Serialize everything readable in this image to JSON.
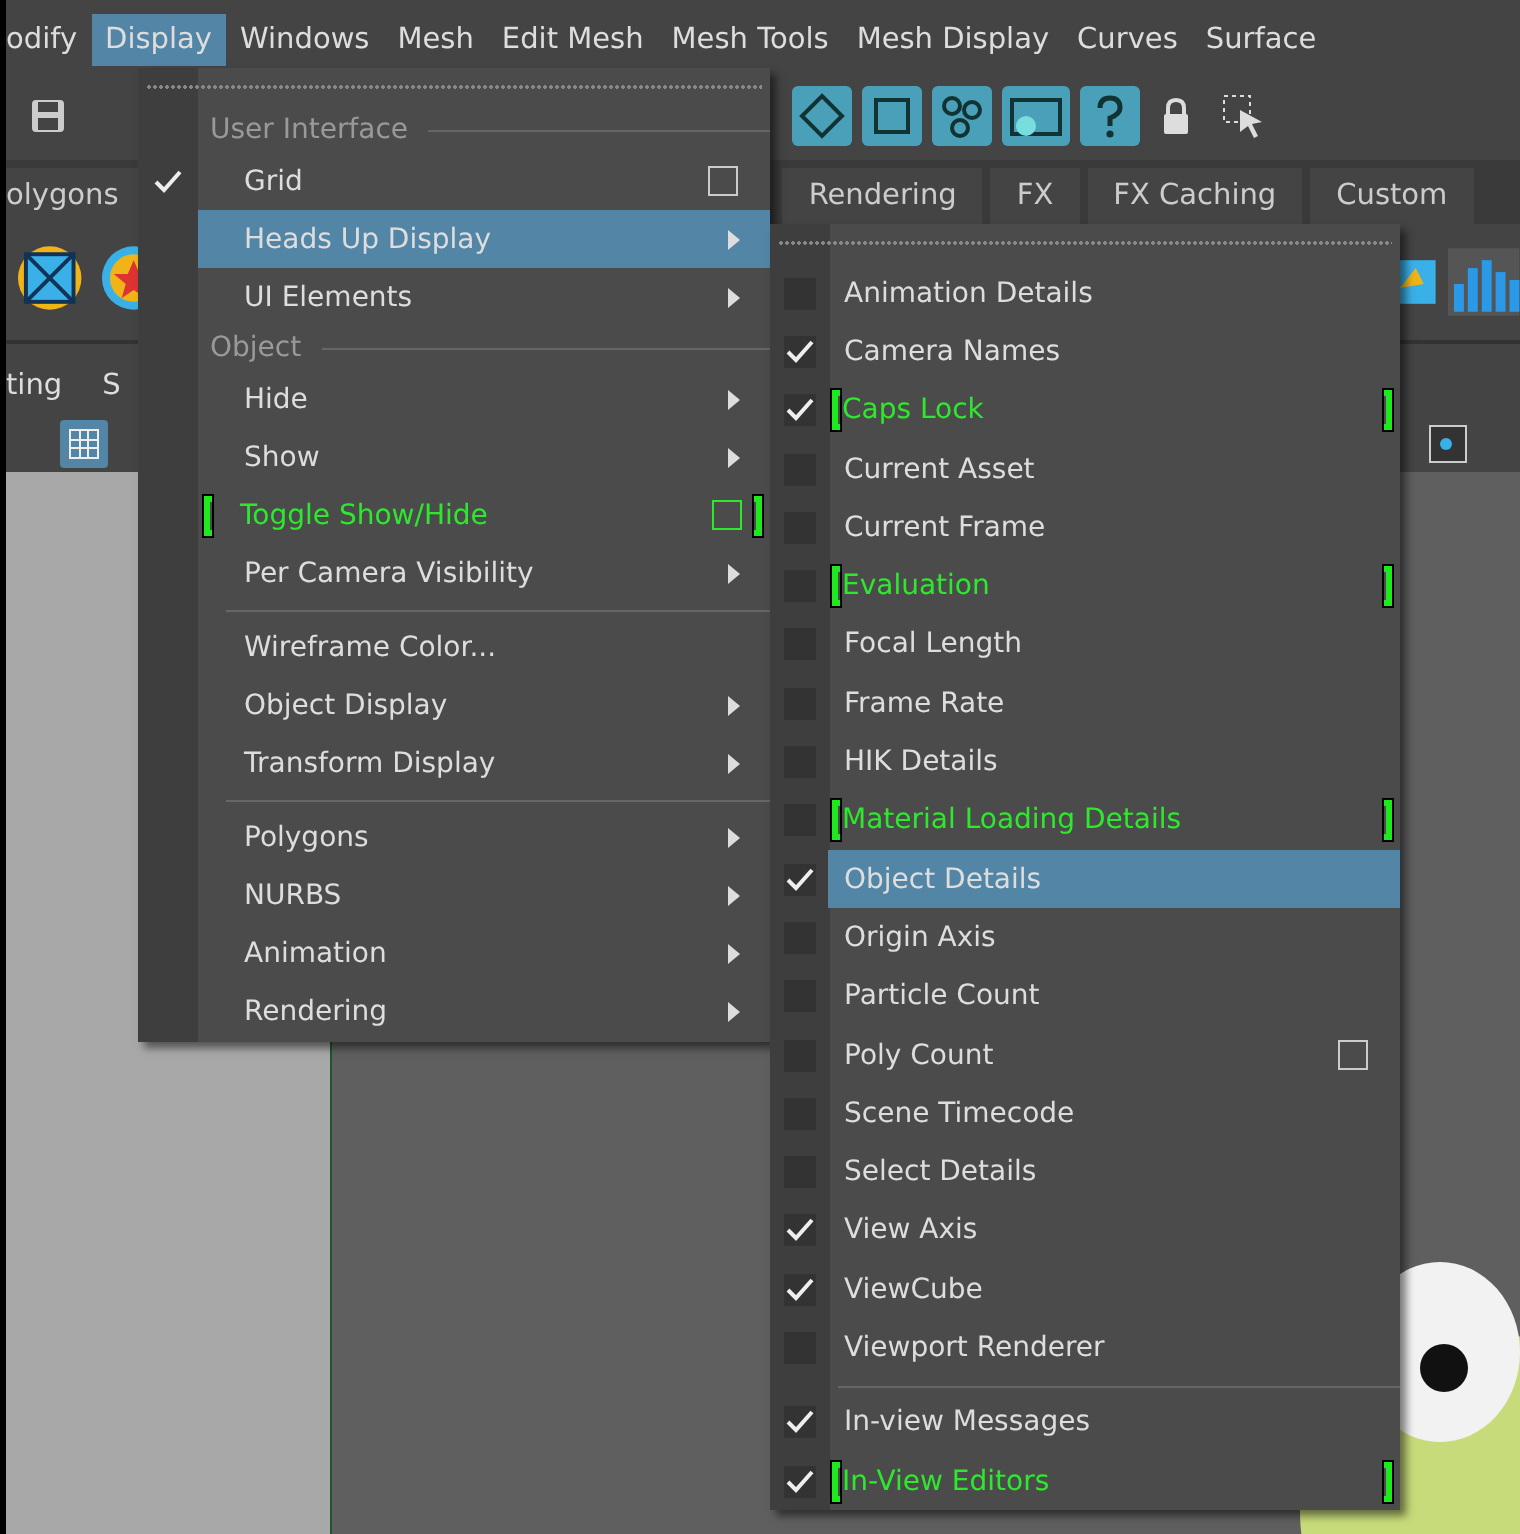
{
  "menubar": [
    {
      "label": "odify",
      "selected": false
    },
    {
      "label": "Display",
      "selected": true
    },
    {
      "label": "Windows",
      "selected": false
    },
    {
      "label": "Mesh",
      "selected": false
    },
    {
      "label": "Edit Mesh",
      "selected": false
    },
    {
      "label": "Mesh Tools",
      "selected": false
    },
    {
      "label": "Mesh Display",
      "selected": false
    },
    {
      "label": "Curves",
      "selected": false
    },
    {
      "label": "Surface",
      "selected": false
    }
  ],
  "shelf_tabs": [
    "olygons",
    "Rendering",
    "FX",
    "FX Caching",
    "Custom"
  ],
  "panel_menu": [
    "ting",
    "S"
  ],
  "display_menu": {
    "items": [
      {
        "kind": "section",
        "label": "User Interface"
      },
      {
        "kind": "item",
        "label": "Grid",
        "checked": true,
        "selected": false,
        "submenu": false,
        "option_box": true,
        "annotated": false
      },
      {
        "kind": "item",
        "label": "Heads Up Display",
        "checked": false,
        "selected": true,
        "submenu": true,
        "option_box": false,
        "annotated": false
      },
      {
        "kind": "item",
        "label": "UI Elements",
        "checked": false,
        "selected": false,
        "submenu": true,
        "option_box": false,
        "annotated": false
      },
      {
        "kind": "section",
        "label": "Object"
      },
      {
        "kind": "item",
        "label": "Hide",
        "checked": false,
        "selected": false,
        "submenu": true,
        "option_box": false,
        "annotated": false
      },
      {
        "kind": "item",
        "label": "Show",
        "checked": false,
        "selected": false,
        "submenu": true,
        "option_box": false,
        "annotated": false
      },
      {
        "kind": "item",
        "label": "Toggle Show/Hide",
        "checked": false,
        "selected": false,
        "submenu": false,
        "option_box": true,
        "annotated": true
      },
      {
        "kind": "item",
        "label": "Per Camera Visibility",
        "checked": false,
        "selected": false,
        "submenu": true,
        "option_box": false,
        "annotated": false
      },
      {
        "kind": "separator"
      },
      {
        "kind": "item",
        "label": "Wireframe Color...",
        "checked": false,
        "selected": false,
        "submenu": false,
        "option_box": false,
        "annotated": false
      },
      {
        "kind": "item",
        "label": "Object Display",
        "checked": false,
        "selected": false,
        "submenu": true,
        "option_box": false,
        "annotated": false
      },
      {
        "kind": "item",
        "label": "Transform Display",
        "checked": false,
        "selected": false,
        "submenu": true,
        "option_box": false,
        "annotated": false
      },
      {
        "kind": "separator"
      },
      {
        "kind": "item",
        "label": "Polygons",
        "checked": false,
        "selected": false,
        "submenu": true,
        "option_box": false,
        "annotated": false
      },
      {
        "kind": "item",
        "label": "NURBS",
        "checked": false,
        "selected": false,
        "submenu": true,
        "option_box": false,
        "annotated": false
      },
      {
        "kind": "item",
        "label": "Animation",
        "checked": false,
        "selected": false,
        "submenu": true,
        "option_box": false,
        "annotated": false
      },
      {
        "kind": "item",
        "label": "Rendering",
        "checked": false,
        "selected": false,
        "submenu": true,
        "option_box": false,
        "annotated": false
      }
    ]
  },
  "hud_menu": {
    "items": [
      {
        "kind": "item",
        "label": "Animation Details",
        "checked": false,
        "selected": false,
        "option_box": false,
        "annotated": false
      },
      {
        "kind": "item",
        "label": "Camera Names",
        "checked": true,
        "selected": false,
        "option_box": false,
        "annotated": false
      },
      {
        "kind": "item",
        "label": "Caps Lock",
        "checked": true,
        "selected": false,
        "option_box": false,
        "annotated": true
      },
      {
        "kind": "item",
        "label": "Current Asset",
        "checked": false,
        "selected": false,
        "option_box": false,
        "annotated": false
      },
      {
        "kind": "item",
        "label": "Current Frame",
        "checked": false,
        "selected": false,
        "option_box": false,
        "annotated": false
      },
      {
        "kind": "item",
        "label": "Evaluation",
        "checked": false,
        "selected": false,
        "option_box": false,
        "annotated": true
      },
      {
        "kind": "item",
        "label": "Focal Length",
        "checked": false,
        "selected": false,
        "option_box": false,
        "annotated": false
      },
      {
        "kind": "item",
        "label": "Frame Rate",
        "checked": false,
        "selected": false,
        "option_box": false,
        "annotated": false
      },
      {
        "kind": "item",
        "label": "HIK Details",
        "checked": false,
        "selected": false,
        "option_box": false,
        "annotated": false
      },
      {
        "kind": "item",
        "label": "Material Loading Details",
        "checked": false,
        "selected": false,
        "option_box": false,
        "annotated": true
      },
      {
        "kind": "item",
        "label": "Object Details",
        "checked": true,
        "selected": true,
        "option_box": false,
        "annotated": false
      },
      {
        "kind": "item",
        "label": "Origin Axis",
        "checked": false,
        "selected": false,
        "option_box": false,
        "annotated": false
      },
      {
        "kind": "item",
        "label": "Particle Count",
        "checked": false,
        "selected": false,
        "option_box": false,
        "annotated": false
      },
      {
        "kind": "item",
        "label": "Poly Count",
        "checked": false,
        "selected": false,
        "option_box": true,
        "annotated": false
      },
      {
        "kind": "item",
        "label": "Scene Timecode",
        "checked": false,
        "selected": false,
        "option_box": false,
        "annotated": false
      },
      {
        "kind": "item",
        "label": "Select Details",
        "checked": false,
        "selected": false,
        "option_box": false,
        "annotated": false
      },
      {
        "kind": "item",
        "label": "View Axis",
        "checked": true,
        "selected": false,
        "option_box": false,
        "annotated": false
      },
      {
        "kind": "item",
        "label": "ViewCube",
        "checked": true,
        "selected": false,
        "option_box": false,
        "annotated": false
      },
      {
        "kind": "item",
        "label": "Viewport Renderer",
        "checked": false,
        "selected": false,
        "option_box": false,
        "annotated": false
      },
      {
        "kind": "separator"
      },
      {
        "kind": "item",
        "label": "In-view Messages",
        "checked": true,
        "selected": false,
        "option_box": false,
        "annotated": false
      },
      {
        "kind": "item",
        "label": "In-View Editors",
        "checked": true,
        "selected": false,
        "option_box": false,
        "annotated": true
      }
    ]
  }
}
